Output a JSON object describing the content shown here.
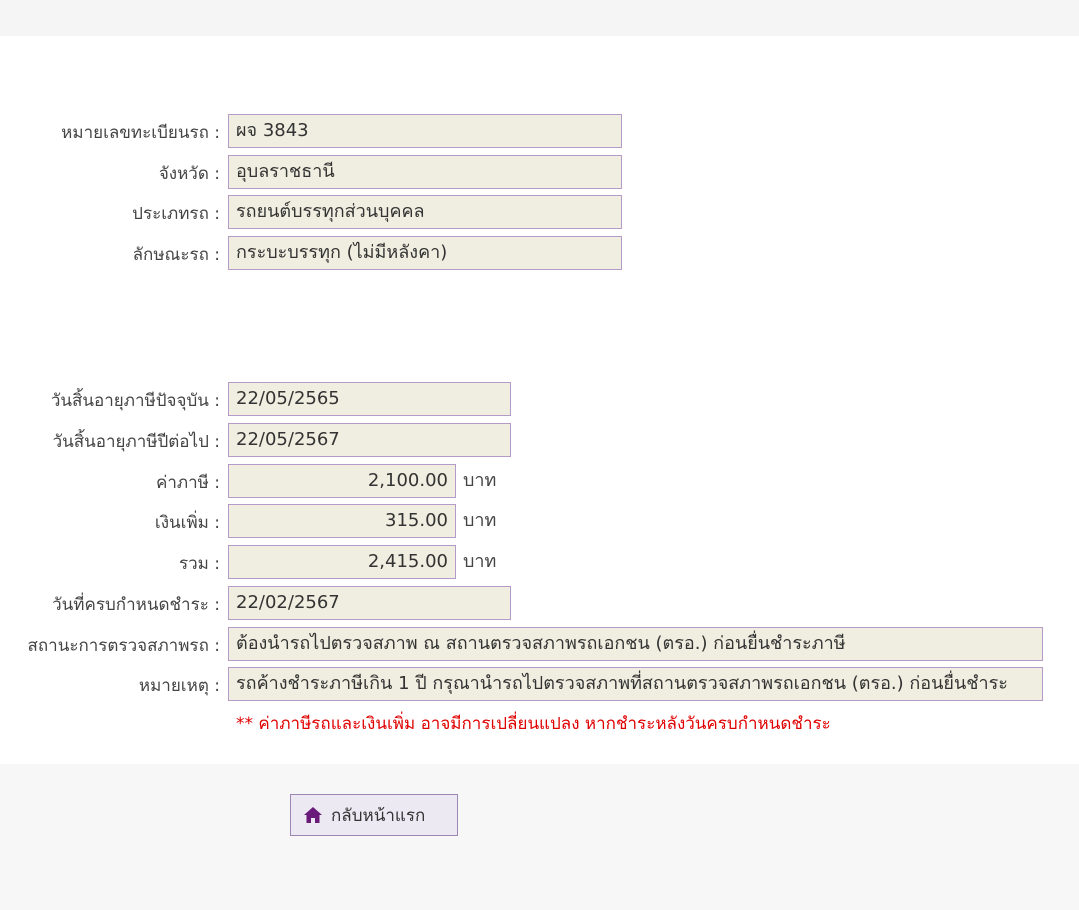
{
  "vehicle": {
    "plate": {
      "label": "หมายเลขทะเบียนรถ :",
      "value": "ผจ 3843"
    },
    "province": {
      "label": "จังหวัด :",
      "value": "อุบลราชธานี"
    },
    "type": {
      "label": "ประเภทรถ :",
      "value": "รถยนต์บรรทุกส่วนบุคคล"
    },
    "style": {
      "label": "ลักษณะรถ :",
      "value": "กระบะบรรทุก (ไม่มีหลังคา)"
    }
  },
  "tax": {
    "current_expiry": {
      "label": "วันสิ้นอายุภาษีปัจจุบัน :",
      "value": "22/05/2565"
    },
    "next_expiry": {
      "label": "วันสิ้นอายุภาษีปีต่อไป :",
      "value": "22/05/2567"
    },
    "tax_amount": {
      "label": "ค่าภาษี :",
      "value": "2,100.00",
      "unit": "บาท"
    },
    "surcharge": {
      "label": "เงินเพิ่ม :",
      "value": "315.00",
      "unit": "บาท"
    },
    "total": {
      "label": "รวม :",
      "value": "2,415.00",
      "unit": "บาท"
    },
    "due_date": {
      "label": "วันที่ครบกำหนดชำระ :",
      "value": "22/02/2567"
    },
    "inspection_status": {
      "label": "สถานะการตรวจสภาพรถ :",
      "value": "ต้องนำรถไปตรวจสภาพ ณ สถานตรวจสภาพรถเอกชน (ตรอ.) ก่อนยื่นชำระภาษี"
    },
    "remark": {
      "label": "หมายเหตุ :",
      "value": "รถค้างชำระภาษีเกิน 1 ปี กรุณานำรถไปตรวจสภาพที่สถานตรวจสภาพรถเอกชน (ตรอ.) ก่อนยื่นชำระ"
    },
    "warning": "** ค่าภาษีรถและเงินเพิ่ม อาจมีการเปลี่ยนแปลง หากชำระหลังวันครบกำหนดชำระ"
  },
  "actions": {
    "home_label": "กลับหน้าแรก",
    "home_icon": "home-icon",
    "accent_color": "#6a1b7a"
  }
}
